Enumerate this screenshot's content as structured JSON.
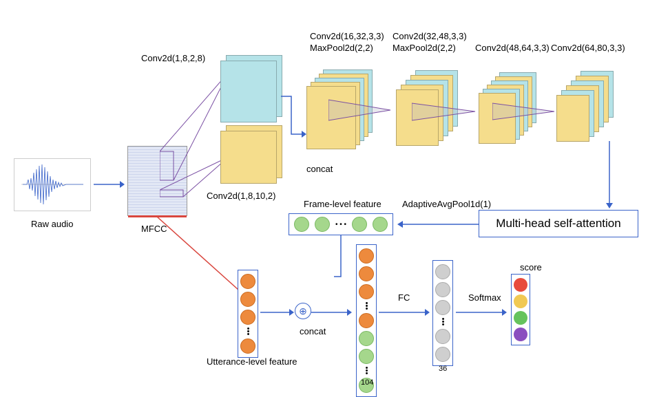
{
  "labels": {
    "conv1_top": "Conv2d(1,8,2,8)",
    "conv1_bottom": "Conv2d(1,8,10,2)",
    "conv2": "Conv2d(16,32,3,3)",
    "maxpool2": "MaxPool2d(2,2)",
    "conv3": "Conv2d(32,48,3,3)",
    "maxpool3": "MaxPool2d(2,2)",
    "conv4": "Conv2d(48,64,3,3)",
    "conv5": "Conv2d(64,80,3,3)",
    "concat1": "concat",
    "concat2": "concat",
    "raw_audio": "Raw audio",
    "mfcc": "MFCC",
    "frame_level": "Frame-level feature",
    "adaptive": "AdaptiveAvgPool1d(1)",
    "attention": "Multi-head self-attention",
    "utterance": "Utterance-level feature",
    "fc": "FC",
    "softmax": "Softmax",
    "score": "score",
    "n104": "104",
    "n36": "36"
  }
}
